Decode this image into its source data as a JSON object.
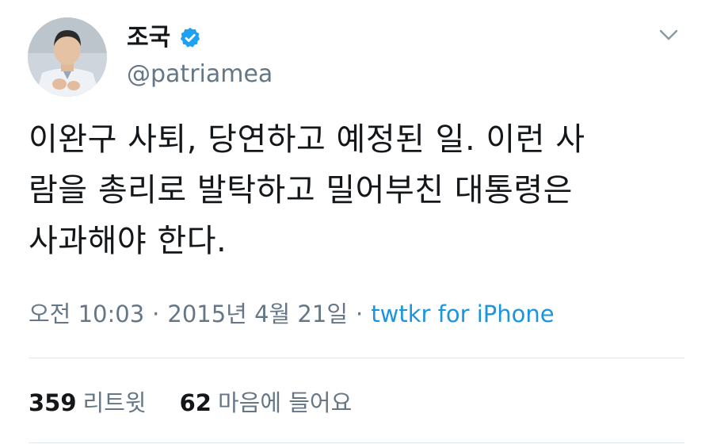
{
  "header": {
    "display_name": "조국",
    "handle": "@patriamea",
    "verified_icon": "verified-badge-icon",
    "menu_icon": "chevron-down-icon"
  },
  "tweet": {
    "text": "이완구 사퇴, 당연하고 예정된 일. 이런 사\n람을 총리로 발탁하고 밀어부친 대통령은\n사과해야 한다."
  },
  "meta": {
    "time": "오전 10:03",
    "separator1": "·",
    "date": "2015년 4월 21일",
    "separator2": "·",
    "source": "twtkr for iPhone"
  },
  "stats": {
    "retweets_count": "359",
    "retweets_label": "리트윗",
    "likes_count": "62",
    "likes_label": "마음에 들어요"
  },
  "colors": {
    "text_primary": "#14171a",
    "text_secondary": "#657786",
    "link": "#1b95e0",
    "verified": "#1da1f2",
    "divider": "#e1e8ed"
  }
}
